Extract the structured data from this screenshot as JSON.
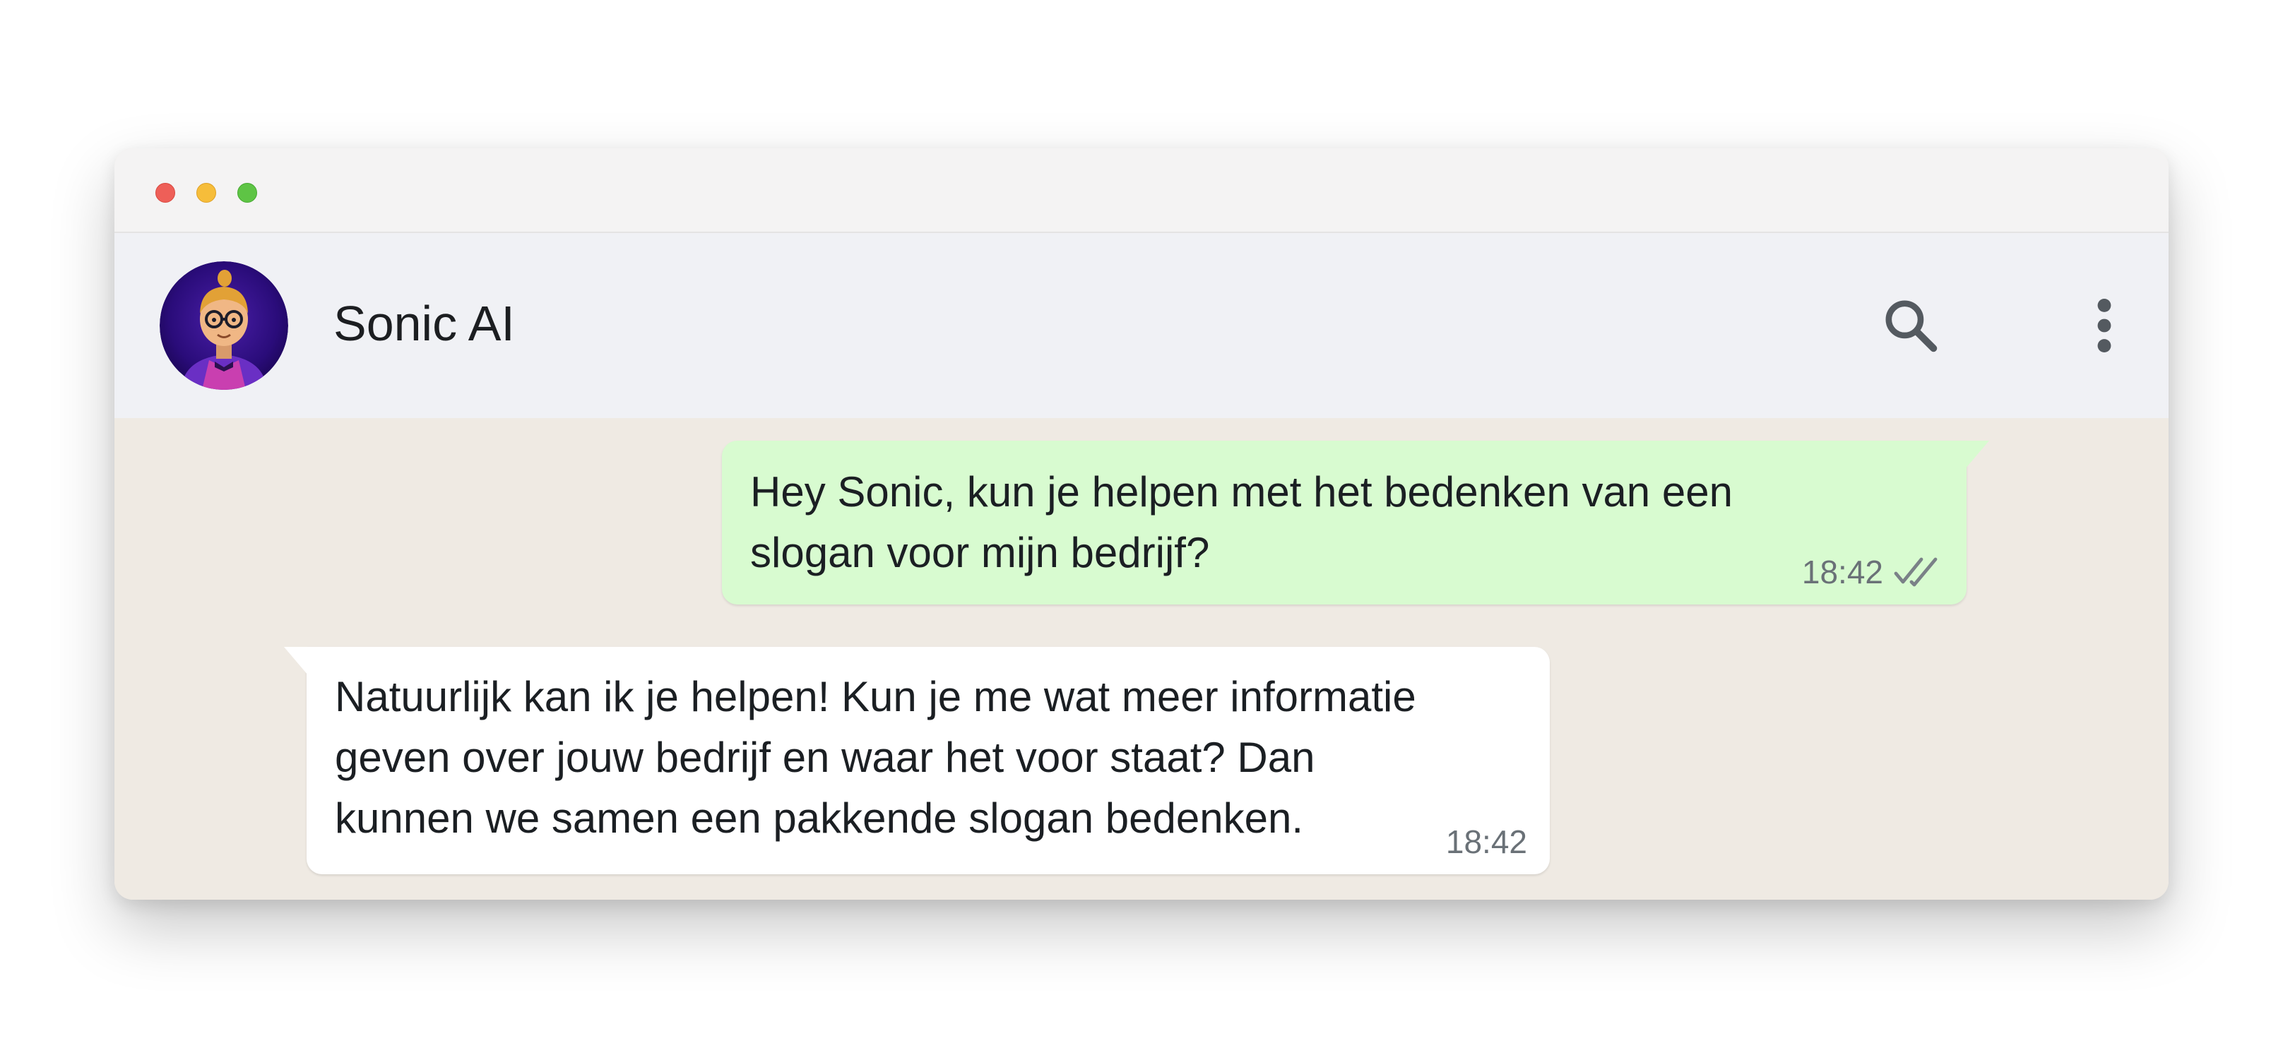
{
  "window": {
    "controls": [
      "close",
      "minimize",
      "zoom"
    ]
  },
  "header": {
    "contact_name": "Sonic AI",
    "avatar_icon": "avatar-illustration",
    "search_icon": "search-icon",
    "menu_icon": "more-vert-icon"
  },
  "messages": [
    {
      "direction": "outgoing",
      "text": "Hey Sonic, kun je helpen met het bedenken van een\nslogan voor mijn bedrijf?",
      "time": "18:42",
      "status_icon": "double-check-icon"
    },
    {
      "direction": "incoming",
      "text": "Natuurlijk kan ik je helpen! Kun je me wat meer informatie\ngeven over jouw bedrijf en waar het voor staat? Dan\nkunnen we samen een pakkende slogan bedenken.",
      "time": "18:42"
    }
  ],
  "colors": {
    "outgoing_bubble": "#d8fbd0",
    "incoming_bubble": "#ffffff",
    "chat_background": "#efeae3",
    "header_background": "#f0f1f5"
  }
}
